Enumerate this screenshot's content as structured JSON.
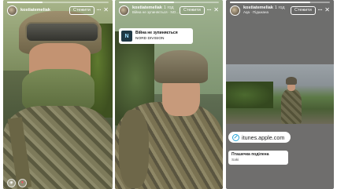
{
  "colors": {
    "panel_bg_3": "#6f6e6d",
    "link_accent": "#2aa7d8",
    "heart": "#ff4c61"
  },
  "stories": [
    {
      "username": "kostiatemeliak",
      "time": "",
      "audio": "",
      "follow_label": "Стежити",
      "more_icon": "more-dots-icon",
      "close_icon": "close-icon",
      "progress": 0.35
    },
    {
      "username": "kostiatemeliak",
      "time": "1 год",
      "audio": "Війна не зупиняється · NORD DIVISION",
      "follow_label": "Стежити",
      "more_icon": "more-dots-icon",
      "close_icon": "close-icon",
      "progress": 0.55,
      "music": {
        "title": "Війна не зупиняється",
        "artist": "NORD DIVISION",
        "art_label": "N"
      }
    },
    {
      "username": "kostiatemeliak",
      "time": "1 год",
      "audio": "Aqa · Підшкана",
      "follow_label": "Стежити",
      "more_icon": "more-dots-icon",
      "close_icon": "close-icon",
      "progress": 0.8,
      "link": {
        "label": "itunes.apple.com"
      },
      "share": {
        "title": "Пташечка поділена",
        "subtitle": "Saki"
      }
    }
  ]
}
